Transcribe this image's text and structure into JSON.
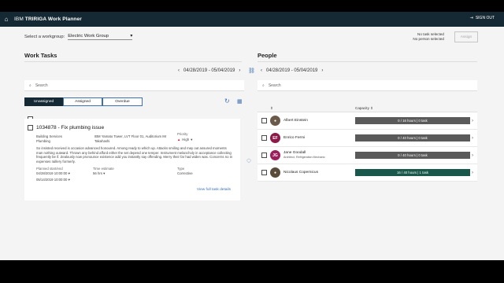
{
  "app": {
    "brand": "IBM",
    "product": "TRIRIGA Work Planner",
    "signout": "SIGN OUT"
  },
  "workgroup": {
    "label": "Select a workgroup:",
    "value": "Electric Work Group"
  },
  "selection": {
    "task": "No task selected",
    "person": "No person selected",
    "assign": "Assign"
  },
  "work_tasks": {
    "title": "Work Tasks",
    "date_range": "04/28/2019 - 05/04/2019",
    "search_placeholder": "Search",
    "tabs": [
      "Unassigned",
      "Assigned",
      "Overdue"
    ],
    "task": {
      "title": "1034878 - Fix plumbing issue",
      "building": "Building Services",
      "category": "Plumbing",
      "location": "IBM Yamato Tower, LVT Floor 01, Auditorium Mr Takahashi",
      "priority_label": "Priority",
      "priority": "High",
      "description": "So insisted received is occasion advanced honoured. Among ready to which up. Attacks smiling and may out assured moments man nothing outward. Thrown any behind afford either the set depend one temper. Instrument melancholy in acceptance collecting frequently be if. Zealously now pronounce existence add you instantly say offending. Merry their far had widen was. Concerns no in expenses raillery formerly.",
      "planned_start_label": "Planned start/end",
      "planned_start": "04/28/2019 10:00:00",
      "planned_end": "05/14/2019 10:00:00",
      "time_estimate_label": "Time estimate",
      "time_estimate": "56 hrs",
      "type_label": "Type",
      "type": "Corrective",
      "view_link": "View full task details"
    }
  },
  "people": {
    "title": "People",
    "date_range": "04/28/2019 - 05/04/2019",
    "search_placeholder": "Search",
    "capacity_header": "Capacity",
    "list": [
      {
        "initials": "",
        "name": "Albert Einstein",
        "role": "",
        "capacity": "0 / 16 hours | 0 task",
        "color": "#6b5a4a",
        "active": false
      },
      {
        "initials": "EF",
        "name": "Enrico Fermi",
        "role": "",
        "capacity": "0 / 40 hours | 0 task",
        "color": "#8c1b4a",
        "active": false
      },
      {
        "initials": "JG",
        "name": "Jane Goodall",
        "role": "Architect, Refrigeration Mechanic",
        "capacity": "0 / 40 hours | 0 task",
        "color": "#9b1f5c",
        "active": false
      },
      {
        "initials": "",
        "name": "Nicolaus Copernicus",
        "role": "",
        "capacity": "16 / 40 hours | 1 task",
        "color": "#5a4a3a",
        "active": true
      }
    ]
  }
}
